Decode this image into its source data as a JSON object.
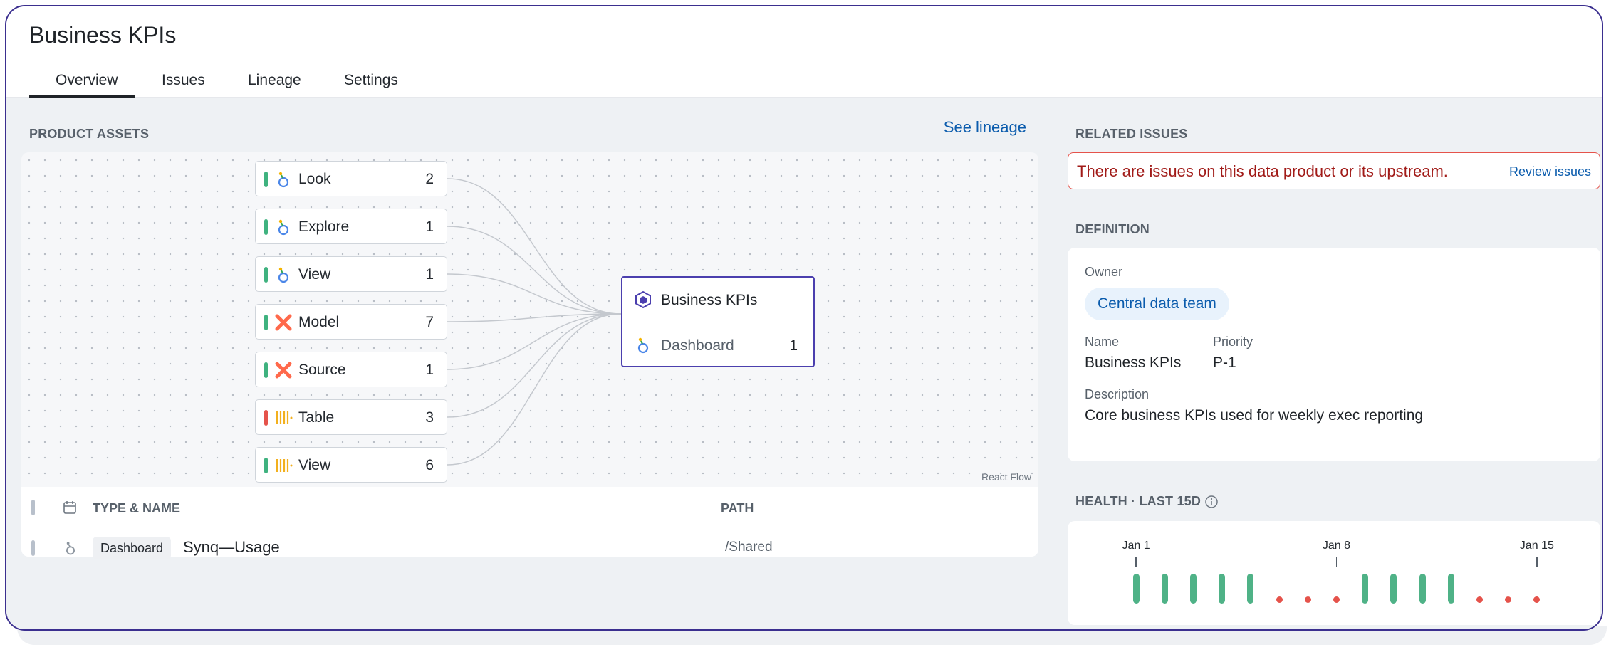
{
  "page": {
    "title": "Business KPIs"
  },
  "tabs": [
    {
      "label": "Overview",
      "active": true
    },
    {
      "label": "Issues"
    },
    {
      "label": "Lineage"
    },
    {
      "label": "Settings"
    }
  ],
  "product_assets": {
    "heading": "PRODUCT ASSETS",
    "see_lineage": "See lineage",
    "flow_nodes": [
      {
        "label": "Look",
        "count": "2",
        "icon": "looker-icon",
        "status": "green"
      },
      {
        "label": "Explore",
        "count": "1",
        "icon": "looker-icon",
        "status": "green"
      },
      {
        "label": "View",
        "count": "1",
        "icon": "looker-icon",
        "status": "green"
      },
      {
        "label": "Model",
        "count": "7",
        "icon": "dbt-icon",
        "status": "green"
      },
      {
        "label": "Source",
        "count": "1",
        "icon": "dbt-icon",
        "status": "green"
      },
      {
        "label": "Table",
        "count": "3",
        "icon": "table-bars-icon",
        "status": "red"
      },
      {
        "label": "View",
        "count": "6",
        "icon": "table-bars-icon",
        "status": "green"
      }
    ],
    "center_node": {
      "title": "Business KPIs",
      "item_label": "Dashboard",
      "item_count": "1",
      "icon": "hexagon-icon",
      "item_icon": "looker-icon"
    },
    "flow_attribution": "React Flow",
    "table": {
      "columns": [
        "TYPE & NAME",
        "PATH"
      ],
      "rows": [
        {
          "type": "Dashboard",
          "name": "Synq—Usage",
          "path": "/Shared"
        }
      ]
    }
  },
  "related_issues": {
    "heading": "RELATED ISSUES",
    "message": "There are issues on this data product or its upstream.",
    "action": "Review issues"
  },
  "definition": {
    "heading": "DEFINITION",
    "owner_label": "Owner",
    "owner": "Central data team",
    "name_label": "Name",
    "name": "Business KPIs",
    "priority_label": "Priority",
    "priority": "P-1",
    "description_label": "Description",
    "description": "Core business KPIs used for weekly exec reporting"
  },
  "health": {
    "heading": "HEALTH · LAST 15D",
    "date_labels": [
      "Jan 1",
      "Jan 8",
      "Jan 15"
    ],
    "days": [
      "ok",
      "ok",
      "ok",
      "ok",
      "ok",
      "fail",
      "fail",
      "fail",
      "ok",
      "ok",
      "ok",
      "ok",
      "fail",
      "fail",
      "fail"
    ],
    "colors": {
      "ok": "#4fb287",
      "fail": "#e5534b"
    }
  },
  "colors": {
    "accent": "#4b3fae",
    "link": "#0b5cad",
    "error": "#e5534b"
  }
}
